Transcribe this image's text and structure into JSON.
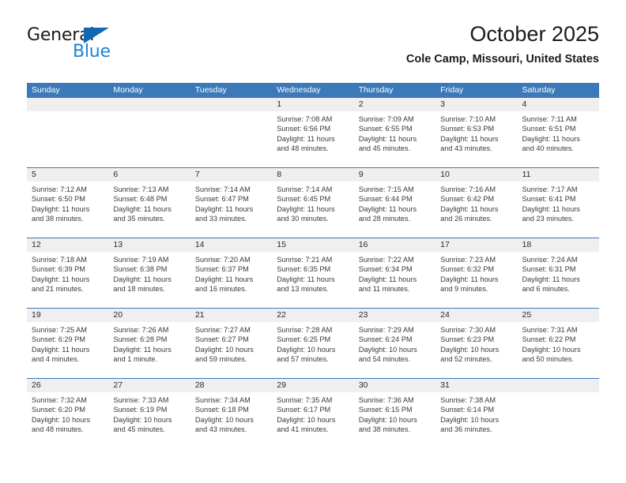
{
  "brand": {
    "name_part1": "General",
    "name_part2": "Blue",
    "triangle_color": "#1267b2",
    "blue_color": "#1b83d6"
  },
  "header": {
    "title": "October 2025",
    "subtitle": "Cole Camp, Missouri, United States",
    "accent_color": "#3b79b8",
    "band_color": "#efefef"
  },
  "weekdays": [
    "Sunday",
    "Monday",
    "Tuesday",
    "Wednesday",
    "Thursday",
    "Friday",
    "Saturday"
  ],
  "weeks": [
    [
      {
        "day": "",
        "sunrise": "",
        "sunset": "",
        "daylight1": "",
        "daylight2": ""
      },
      {
        "day": "",
        "sunrise": "",
        "sunset": "",
        "daylight1": "",
        "daylight2": ""
      },
      {
        "day": "",
        "sunrise": "",
        "sunset": "",
        "daylight1": "",
        "daylight2": ""
      },
      {
        "day": "1",
        "sunrise": "Sunrise: 7:08 AM",
        "sunset": "Sunset: 6:56 PM",
        "daylight1": "Daylight: 11 hours",
        "daylight2": "and 48 minutes."
      },
      {
        "day": "2",
        "sunrise": "Sunrise: 7:09 AM",
        "sunset": "Sunset: 6:55 PM",
        "daylight1": "Daylight: 11 hours",
        "daylight2": "and 45 minutes."
      },
      {
        "day": "3",
        "sunrise": "Sunrise: 7:10 AM",
        "sunset": "Sunset: 6:53 PM",
        "daylight1": "Daylight: 11 hours",
        "daylight2": "and 43 minutes."
      },
      {
        "day": "4",
        "sunrise": "Sunrise: 7:11 AM",
        "sunset": "Sunset: 6:51 PM",
        "daylight1": "Daylight: 11 hours",
        "daylight2": "and 40 minutes."
      }
    ],
    [
      {
        "day": "5",
        "sunrise": "Sunrise: 7:12 AM",
        "sunset": "Sunset: 6:50 PM",
        "daylight1": "Daylight: 11 hours",
        "daylight2": "and 38 minutes."
      },
      {
        "day": "6",
        "sunrise": "Sunrise: 7:13 AM",
        "sunset": "Sunset: 6:48 PM",
        "daylight1": "Daylight: 11 hours",
        "daylight2": "and 35 minutes."
      },
      {
        "day": "7",
        "sunrise": "Sunrise: 7:14 AM",
        "sunset": "Sunset: 6:47 PM",
        "daylight1": "Daylight: 11 hours",
        "daylight2": "and 33 minutes."
      },
      {
        "day": "8",
        "sunrise": "Sunrise: 7:14 AM",
        "sunset": "Sunset: 6:45 PM",
        "daylight1": "Daylight: 11 hours",
        "daylight2": "and 30 minutes."
      },
      {
        "day": "9",
        "sunrise": "Sunrise: 7:15 AM",
        "sunset": "Sunset: 6:44 PM",
        "daylight1": "Daylight: 11 hours",
        "daylight2": "and 28 minutes."
      },
      {
        "day": "10",
        "sunrise": "Sunrise: 7:16 AM",
        "sunset": "Sunset: 6:42 PM",
        "daylight1": "Daylight: 11 hours",
        "daylight2": "and 26 minutes."
      },
      {
        "day": "11",
        "sunrise": "Sunrise: 7:17 AM",
        "sunset": "Sunset: 6:41 PM",
        "daylight1": "Daylight: 11 hours",
        "daylight2": "and 23 minutes."
      }
    ],
    [
      {
        "day": "12",
        "sunrise": "Sunrise: 7:18 AM",
        "sunset": "Sunset: 6:39 PM",
        "daylight1": "Daylight: 11 hours",
        "daylight2": "and 21 minutes."
      },
      {
        "day": "13",
        "sunrise": "Sunrise: 7:19 AM",
        "sunset": "Sunset: 6:38 PM",
        "daylight1": "Daylight: 11 hours",
        "daylight2": "and 18 minutes."
      },
      {
        "day": "14",
        "sunrise": "Sunrise: 7:20 AM",
        "sunset": "Sunset: 6:37 PM",
        "daylight1": "Daylight: 11 hours",
        "daylight2": "and 16 minutes."
      },
      {
        "day": "15",
        "sunrise": "Sunrise: 7:21 AM",
        "sunset": "Sunset: 6:35 PM",
        "daylight1": "Daylight: 11 hours",
        "daylight2": "and 13 minutes."
      },
      {
        "day": "16",
        "sunrise": "Sunrise: 7:22 AM",
        "sunset": "Sunset: 6:34 PM",
        "daylight1": "Daylight: 11 hours",
        "daylight2": "and 11 minutes."
      },
      {
        "day": "17",
        "sunrise": "Sunrise: 7:23 AM",
        "sunset": "Sunset: 6:32 PM",
        "daylight1": "Daylight: 11 hours",
        "daylight2": "and 9 minutes."
      },
      {
        "day": "18",
        "sunrise": "Sunrise: 7:24 AM",
        "sunset": "Sunset: 6:31 PM",
        "daylight1": "Daylight: 11 hours",
        "daylight2": "and 6 minutes."
      }
    ],
    [
      {
        "day": "19",
        "sunrise": "Sunrise: 7:25 AM",
        "sunset": "Sunset: 6:29 PM",
        "daylight1": "Daylight: 11 hours",
        "daylight2": "and 4 minutes."
      },
      {
        "day": "20",
        "sunrise": "Sunrise: 7:26 AM",
        "sunset": "Sunset: 6:28 PM",
        "daylight1": "Daylight: 11 hours",
        "daylight2": "and 1 minute."
      },
      {
        "day": "21",
        "sunrise": "Sunrise: 7:27 AM",
        "sunset": "Sunset: 6:27 PM",
        "daylight1": "Daylight: 10 hours",
        "daylight2": "and 59 minutes."
      },
      {
        "day": "22",
        "sunrise": "Sunrise: 7:28 AM",
        "sunset": "Sunset: 6:25 PM",
        "daylight1": "Daylight: 10 hours",
        "daylight2": "and 57 minutes."
      },
      {
        "day": "23",
        "sunrise": "Sunrise: 7:29 AM",
        "sunset": "Sunset: 6:24 PM",
        "daylight1": "Daylight: 10 hours",
        "daylight2": "and 54 minutes."
      },
      {
        "day": "24",
        "sunrise": "Sunrise: 7:30 AM",
        "sunset": "Sunset: 6:23 PM",
        "daylight1": "Daylight: 10 hours",
        "daylight2": "and 52 minutes."
      },
      {
        "day": "25",
        "sunrise": "Sunrise: 7:31 AM",
        "sunset": "Sunset: 6:22 PM",
        "daylight1": "Daylight: 10 hours",
        "daylight2": "and 50 minutes."
      }
    ],
    [
      {
        "day": "26",
        "sunrise": "Sunrise: 7:32 AM",
        "sunset": "Sunset: 6:20 PM",
        "daylight1": "Daylight: 10 hours",
        "daylight2": "and 48 minutes."
      },
      {
        "day": "27",
        "sunrise": "Sunrise: 7:33 AM",
        "sunset": "Sunset: 6:19 PM",
        "daylight1": "Daylight: 10 hours",
        "daylight2": "and 45 minutes."
      },
      {
        "day": "28",
        "sunrise": "Sunrise: 7:34 AM",
        "sunset": "Sunset: 6:18 PM",
        "daylight1": "Daylight: 10 hours",
        "daylight2": "and 43 minutes."
      },
      {
        "day": "29",
        "sunrise": "Sunrise: 7:35 AM",
        "sunset": "Sunset: 6:17 PM",
        "daylight1": "Daylight: 10 hours",
        "daylight2": "and 41 minutes."
      },
      {
        "day": "30",
        "sunrise": "Sunrise: 7:36 AM",
        "sunset": "Sunset: 6:15 PM",
        "daylight1": "Daylight: 10 hours",
        "daylight2": "and 38 minutes."
      },
      {
        "day": "31",
        "sunrise": "Sunrise: 7:38 AM",
        "sunset": "Sunset: 6:14 PM",
        "daylight1": "Daylight: 10 hours",
        "daylight2": "and 36 minutes."
      },
      {
        "day": "",
        "sunrise": "",
        "sunset": "",
        "daylight1": "",
        "daylight2": ""
      }
    ]
  ]
}
